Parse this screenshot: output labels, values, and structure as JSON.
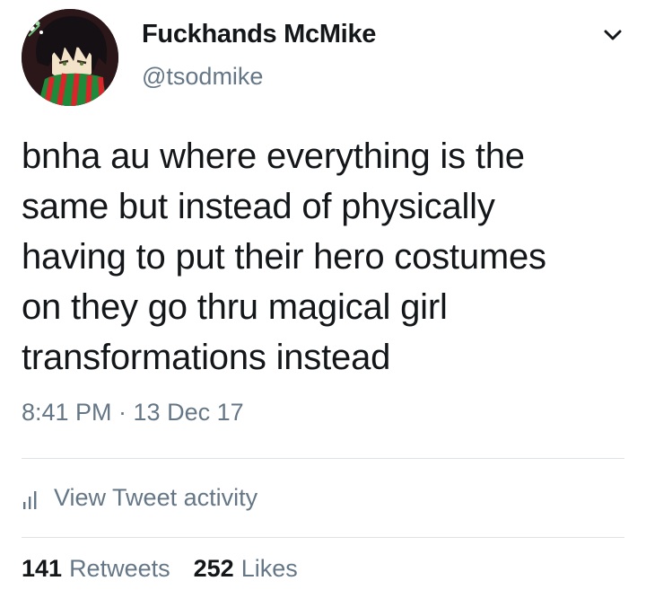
{
  "author": {
    "display_name": "Fuckhands McMike",
    "handle": "@tsodmike",
    "avatar_icon": "avatar-illustration"
  },
  "menu": {
    "icon": "chevron-down-icon"
  },
  "tweet": {
    "lines": [
      "bnha au where everything is the",
      "same but instead of physically",
      "having to put their hero costumes",
      "on they go thru magical girl",
      "transformations instead"
    ],
    "timestamp": "8:41 PM · 13 Dec 17"
  },
  "activity": {
    "label": "View Tweet activity",
    "icon": "bar-chart-icon"
  },
  "stats": {
    "retweets_count": "141",
    "retweets_label": "Retweets",
    "likes_count": "252",
    "likes_label": "Likes"
  },
  "colors": {
    "text_primary": "#14171a",
    "text_secondary": "#657786",
    "divider": "#dfe3e6",
    "background": "#ffffff"
  }
}
